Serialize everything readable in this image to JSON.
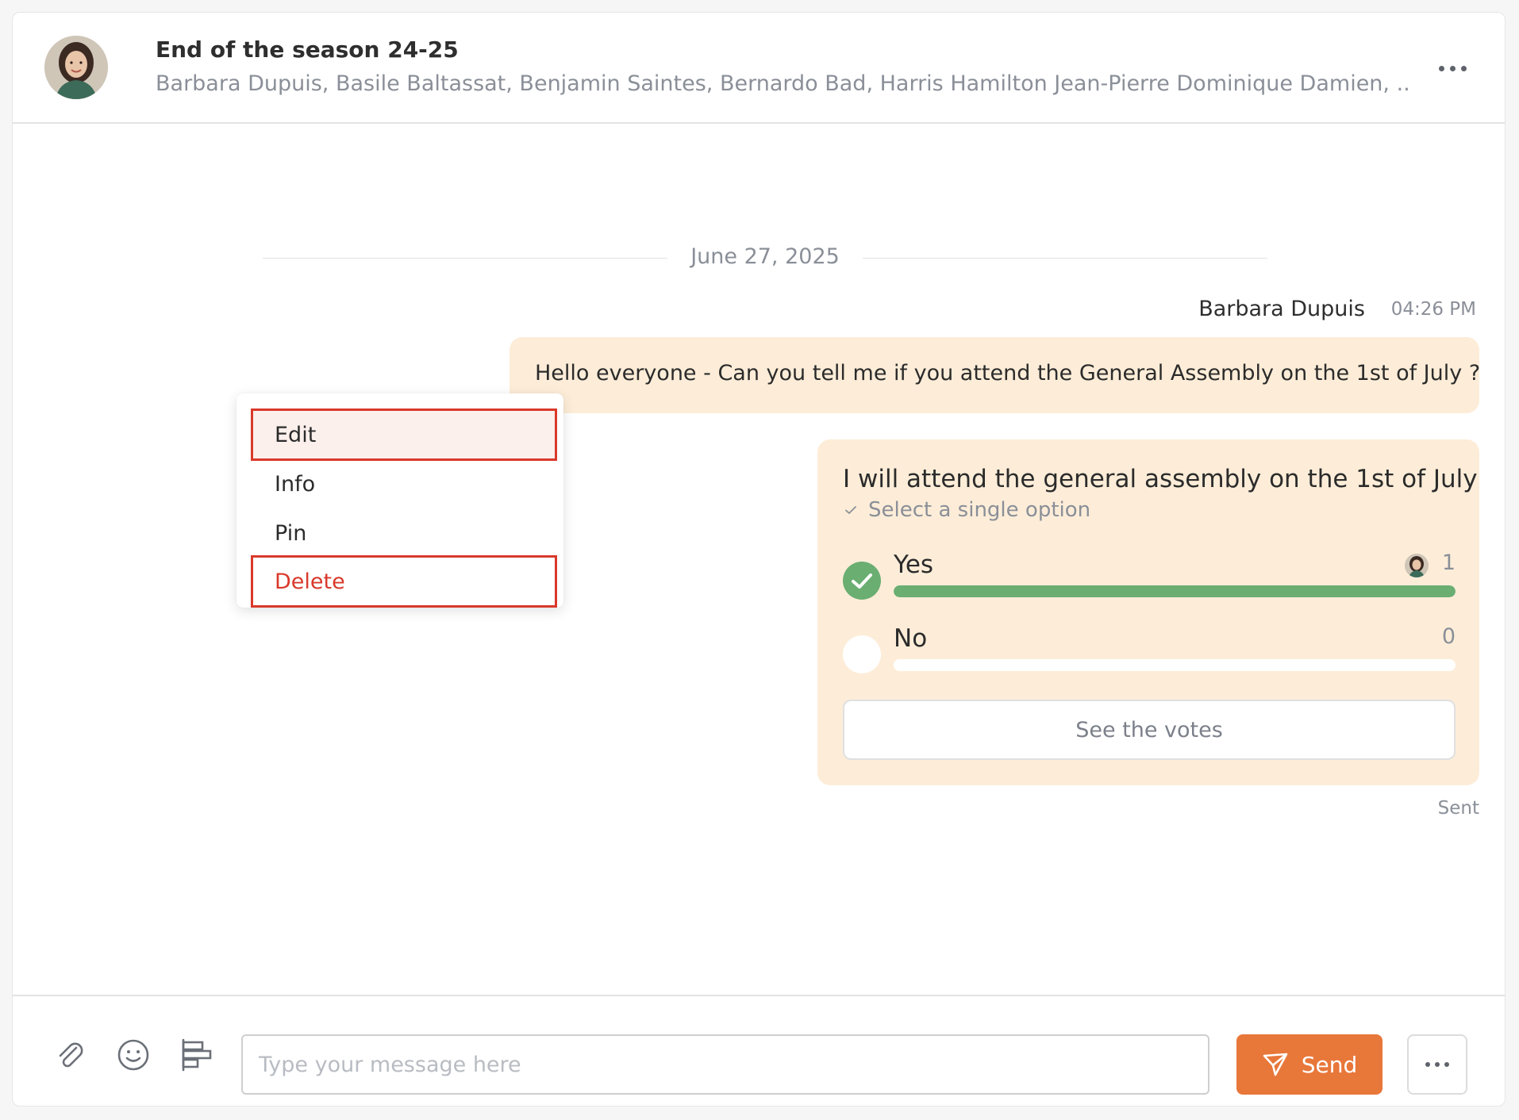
{
  "header": {
    "title": "End of the season 24-25",
    "participants": "Barbara Dupuis, Basile Baltassat, Benjamin Saintes, Bernardo Bad, Harris Hamilton Jean-Pierre Dominique Damien, ..."
  },
  "thread": {
    "date_separator": "June 27, 2025",
    "message": {
      "sender": "Barbara Dupuis",
      "time": "04:26 PM",
      "text": "Hello everyone - Can you tell me if you attend the General Assembly on the 1st of July ?"
    },
    "poll": {
      "question": "I will attend the general assembly on the 1st of July",
      "hint": "Select a single option",
      "options": [
        {
          "label": "Yes",
          "count": "1",
          "selected": true,
          "share": 1.0
        },
        {
          "label": "No",
          "count": "0",
          "selected": false,
          "share": 0.0
        }
      ],
      "see_votes_label": "See the votes"
    },
    "status": "Sent"
  },
  "context_menu": {
    "items": [
      {
        "label": "Edit"
      },
      {
        "label": "Info"
      },
      {
        "label": "Pin"
      },
      {
        "label": "Delete"
      }
    ]
  },
  "composer": {
    "placeholder": "Type your message here",
    "send_label": "Send"
  },
  "colors": {
    "accent": "#e8773a",
    "bubble": "#fdedd8",
    "poll_fill": "#6aae72",
    "danger": "#d9392b"
  },
  "icons": {
    "attach": "paperclip-icon",
    "emoji": "smiley-icon",
    "poll": "poll-icon",
    "send": "paper-plane-icon",
    "more": "ellipsis-icon"
  }
}
